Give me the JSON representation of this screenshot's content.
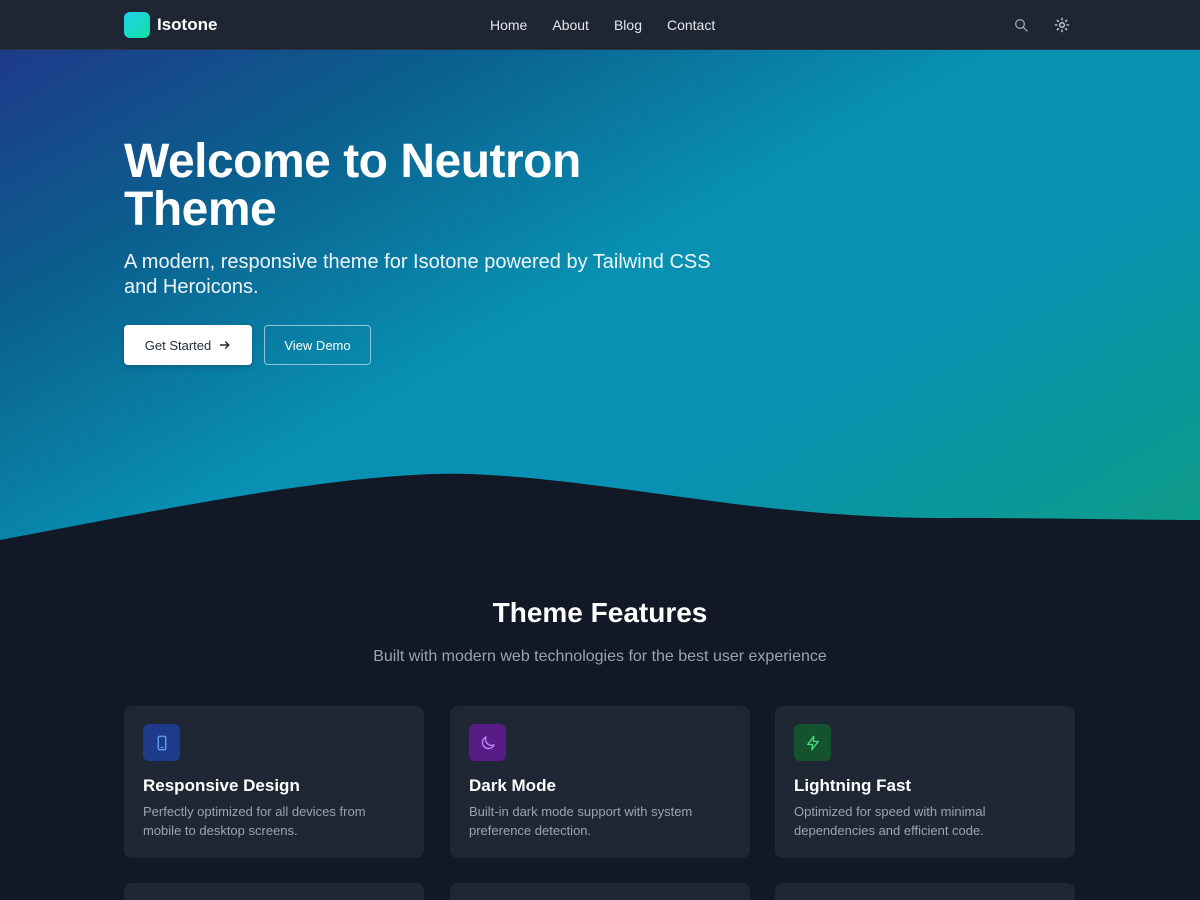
{
  "header": {
    "brand": "Isotone",
    "nav": [
      "Home",
      "About",
      "Blog",
      "Contact"
    ],
    "icons": [
      "search-icon",
      "sun-icon"
    ]
  },
  "hero": {
    "title": "Welcome to Neutron Theme",
    "subtitle": "A modern, responsive theme for Isotone powered by Tailwind CSS and Heroicons.",
    "primary_button": "Get Started",
    "secondary_button": "View Demo"
  },
  "features": {
    "title": "Theme Features",
    "subtitle": "Built with modern web technologies for the best user experience",
    "cards": [
      {
        "title": "Responsive Design",
        "description": "Perfectly optimized for all devices from mobile to desktop screens.",
        "icon": "device-phone-icon",
        "icon_bg": "#1e3a8a",
        "icon_color": "#60a5fa"
      },
      {
        "title": "Dark Mode",
        "description": "Built-in dark mode support with system preference detection.",
        "icon": "moon-icon",
        "icon_bg": "#581c87",
        "icon_color": "#c084fc"
      },
      {
        "title": "Lightning Fast",
        "description": "Optimized for speed with minimal dependencies and efficient code.",
        "icon": "bolt-icon",
        "icon_bg": "#14532d",
        "icon_color": "#4ade80"
      }
    ]
  },
  "colors": {
    "page_bg": "#121826",
    "header_bg": "#1e2533",
    "card_bg": "#1f2735",
    "hero_gradient": [
      "#1e3a8a",
      "#0891b2",
      "#0f9d86"
    ]
  }
}
